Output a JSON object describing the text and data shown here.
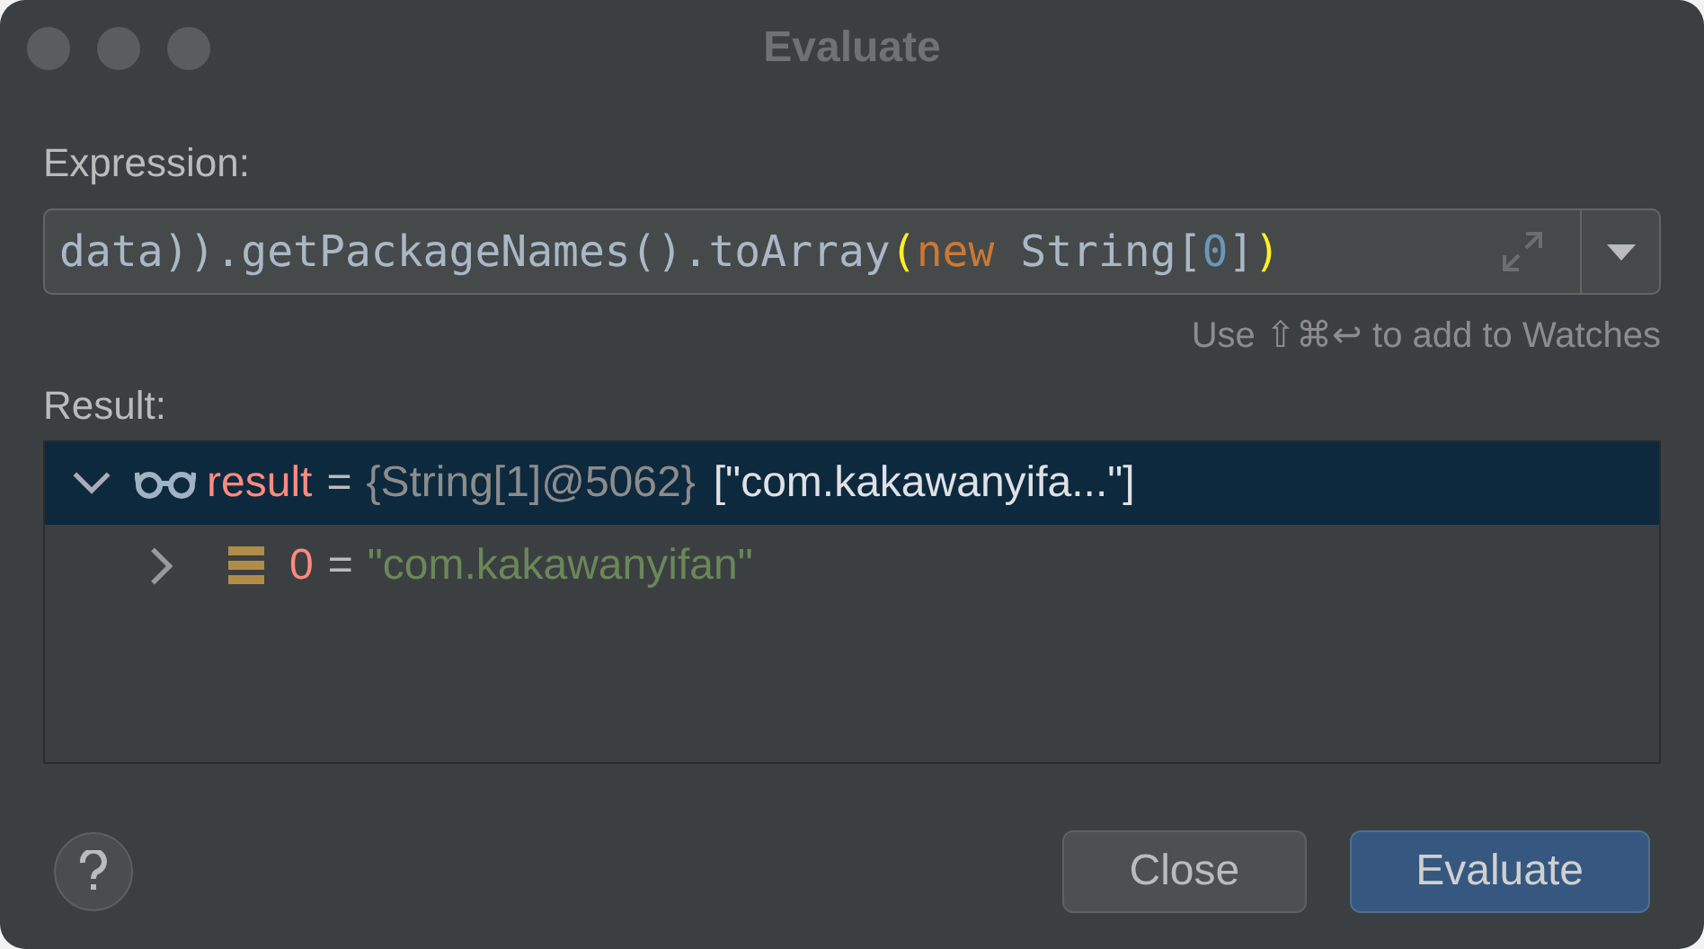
{
  "window": {
    "title": "Evaluate"
  },
  "expression": {
    "label": "Expression:",
    "tokens": [
      {
        "text": "data)).getPackageNames().toArray",
        "kind": "plain"
      },
      {
        "text": "(",
        "kind": "paren"
      },
      {
        "text": "new",
        "kind": "keyword"
      },
      {
        "text": " String[",
        "kind": "plain"
      },
      {
        "text": "0",
        "kind": "number"
      },
      {
        "text": "]",
        "kind": "plain"
      },
      {
        "text": ")",
        "kind": "paren"
      }
    ],
    "hint": "Use ⇧⌘↩ to add to Watches"
  },
  "result": {
    "label": "Result:",
    "tree": [
      {
        "kind": "watch",
        "name": "result",
        "separator": "=",
        "type": "{String[1]@5062}",
        "value": "[\"com.kakawanyifa...\"]",
        "expanded": true,
        "selected": true,
        "children": [
          {
            "kind": "element",
            "name": "0",
            "separator": "=",
            "value": "\"com.kakawanyifan\"",
            "expanded": false,
            "selected": false
          }
        ]
      }
    ]
  },
  "buttons": [
    {
      "label": "Close",
      "kind": "secondary"
    },
    {
      "label": "Evaluate",
      "kind": "primary"
    }
  ]
}
